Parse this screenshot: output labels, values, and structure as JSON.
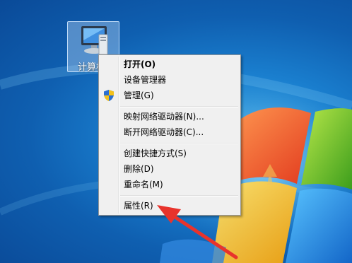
{
  "desktop": {
    "computer_icon": {
      "label": "计算机"
    }
  },
  "context_menu": {
    "items": [
      {
        "label": "打开(O)",
        "bold": true
      },
      {
        "label": "设备管理器"
      },
      {
        "label": "管理(G)",
        "icon": "uac-shield-icon"
      },
      {
        "label": "映射网络驱动器(N)..."
      },
      {
        "label": "断开网络驱动器(C)..."
      },
      {
        "label": "创建快捷方式(S)"
      },
      {
        "label": "删除(D)"
      },
      {
        "label": "重命名(M)"
      },
      {
        "label": "属性(R)"
      }
    ]
  },
  "annotation": {
    "color": "#e8332c",
    "points_to": "属性(R)"
  }
}
